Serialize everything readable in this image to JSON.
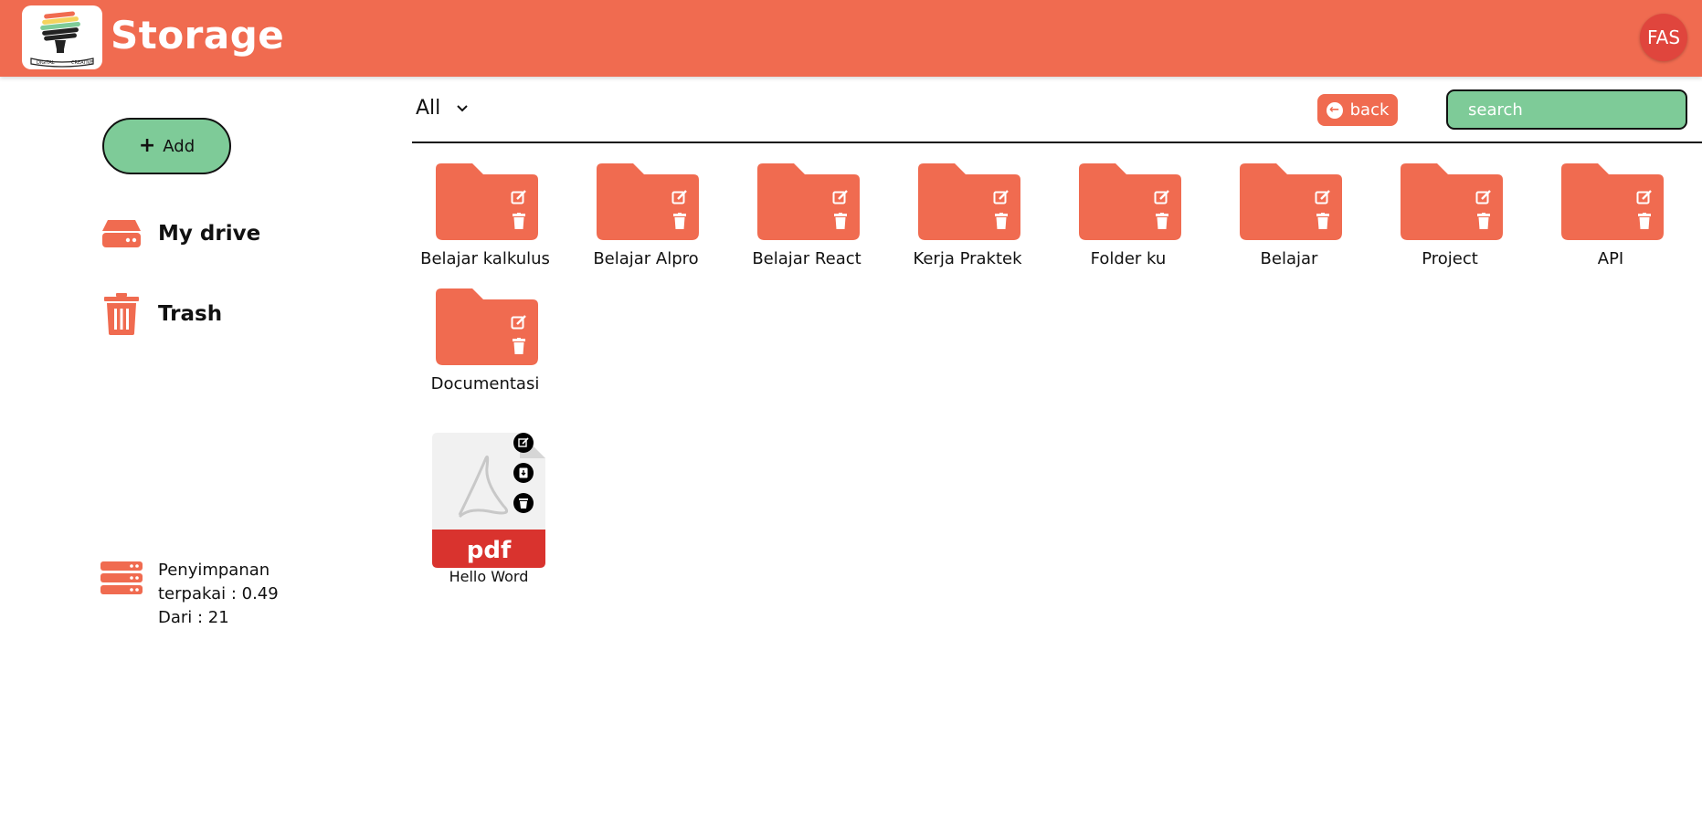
{
  "header": {
    "title": "Storage",
    "avatar_initials": "FAS",
    "logo_text_left": "DIGITAL",
    "logo_text_right": "CREATIVE"
  },
  "sidebar": {
    "add_label": "Add",
    "items": [
      {
        "label": "My drive",
        "icon": "hard-drive-icon"
      },
      {
        "label": "Trash",
        "icon": "trash-icon"
      }
    ],
    "storage": {
      "line1": "Penyimpanan",
      "line2": "terpakai : 0.49",
      "line3": "Dari : 21",
      "icon": "server-icon"
    }
  },
  "toolbar": {
    "filter_value": "All",
    "back_label": "back",
    "search_placeholder": "search"
  },
  "folders": [
    {
      "name": "Belajar kalkulus"
    },
    {
      "name": "Belajar Alpro"
    },
    {
      "name": "Belajar React"
    },
    {
      "name": "Kerja Praktek"
    },
    {
      "name": "Folder ku"
    },
    {
      "name": "Belajar"
    },
    {
      "name": "Project"
    },
    {
      "name": "API"
    },
    {
      "name": "Documentasi"
    }
  ],
  "files": [
    {
      "name": "Hello Word",
      "type_label": "pdf"
    }
  ],
  "colors": {
    "brand": "#f06b50",
    "accent_green": "#7ecb98",
    "avatar": "#e0453d",
    "pdf_red": "#d9332e"
  }
}
